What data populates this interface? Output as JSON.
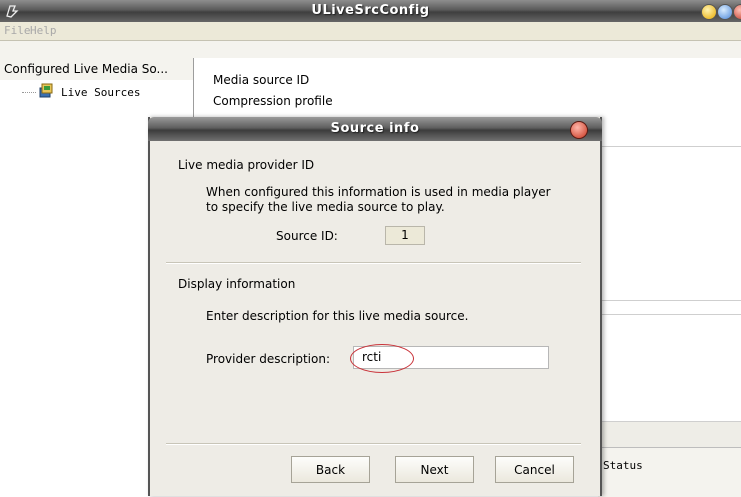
{
  "window": {
    "title": "ULiveSrcConfig"
  },
  "menu": {
    "items": [
      "File",
      "Help"
    ]
  },
  "tree": {
    "root": "Configured Live Media So...",
    "child": "Live Sources"
  },
  "properties": {
    "media_source_id": "Media source ID",
    "compression_profile": "Compression profile"
  },
  "status": {
    "label": "Status"
  },
  "dialog": {
    "title": "Source info",
    "section1_title": "Live media provider ID",
    "section1_text_line1": "When configured this information is used in media player",
    "section1_text_line2": "to specify the live media source to play.",
    "source_id_label": "Source ID:",
    "source_id_value": "1",
    "section2_title": "Display information",
    "section2_text": "Enter description for this live media source.",
    "provider_label": "Provider description:",
    "provider_value": "rcti",
    "buttons": {
      "back": "Back",
      "next": "Next",
      "cancel": "Cancel"
    }
  },
  "colors": {
    "title_gradient_dark": "#3f3f3f",
    "highlight_circle": "#c9333a"
  }
}
